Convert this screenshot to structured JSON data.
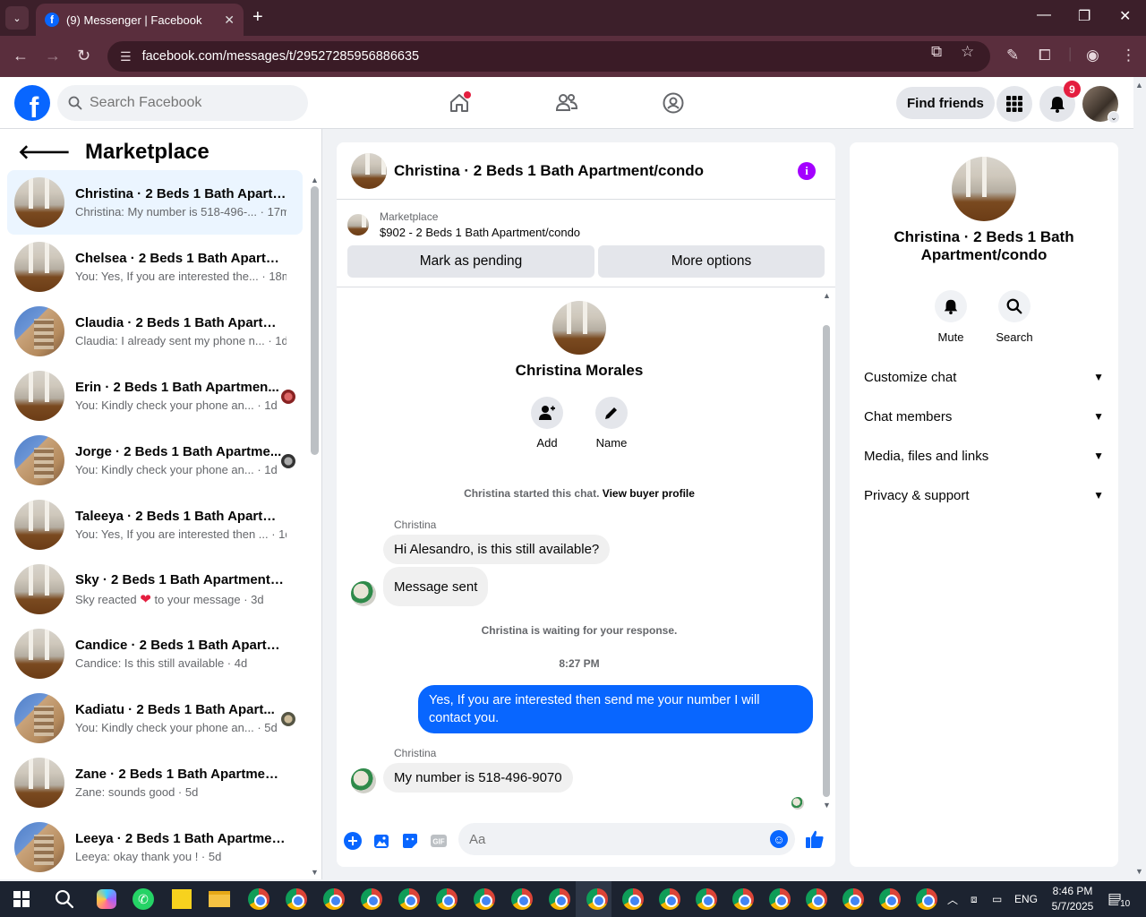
{
  "browser": {
    "tab_title": "(9) Messenger | Facebook",
    "url": "facebook.com/messages/t/29527285956886635"
  },
  "header": {
    "search_placeholder": "Search Facebook",
    "find_friends": "Find friends",
    "notification_count": "9"
  },
  "sidebar": {
    "title": "Marketplace",
    "conversations": [
      {
        "name": "Christina · 2 Beds 1 Bath Apartm...",
        "preview": "Christina: My number is 518-496-... · 17m",
        "avatar": "room",
        "active": true
      },
      {
        "name": "Chelsea · 2 Beds 1 Bath Apartme...",
        "preview": "You: Yes, If you are interested the... · 18m",
        "avatar": "room"
      },
      {
        "name": "Claudia · 2 Beds 1 Bath Apartme...",
        "preview": "Claudia: I already sent my phone n... · 1d",
        "avatar": "building"
      },
      {
        "name": "Erin · 2 Beds 1 Bath Apartmen...",
        "preview": "You: Kindly check your phone an... · 1d",
        "avatar": "room",
        "seen": true
      },
      {
        "name": "Jorge · 2 Beds 1 Bath Apartme...",
        "preview": "You: Kindly check your phone an... · 1d",
        "avatar": "building",
        "seen": true
      },
      {
        "name": "Taleeya · 2 Beds 1 Bath Apartme...",
        "preview": "You: Yes, If you are interested then ... · 1d",
        "avatar": "room"
      },
      {
        "name": "Sky · 2 Beds 1 Bath Apartment/c...",
        "preview_a": "Sky reacted",
        "preview_b": "to your message · 3d",
        "avatar": "room",
        "reaction": "❤"
      },
      {
        "name": "Candice · 2 Beds 1 Bath Apartme...",
        "preview": "Candice: Is this still available · 4d",
        "avatar": "room"
      },
      {
        "name": "Kadiatu · 2 Beds 1 Bath Apart...",
        "preview": "You: Kindly check your phone an... · 5d",
        "avatar": "building",
        "seen": true
      },
      {
        "name": "Zane · 2 Beds 1 Bath Apartment/...",
        "preview": "Zane: sounds good · 5d",
        "avatar": "room"
      },
      {
        "name": "Leeya · 2 Beds 1 Bath Apartment...",
        "preview": "Leeya: okay thank you ! · 5d",
        "avatar": "building"
      }
    ]
  },
  "chat": {
    "title": "Christina · 2 Beds 1 Bath Apartment/condo",
    "marketplace_label": "Marketplace",
    "listing": "$902 - 2 Beds 1 Bath Apartment/condo",
    "mark_pending": "Mark as pending",
    "more_options": "More options",
    "profile_name": "Christina Morales",
    "add_label": "Add",
    "name_label": "Name",
    "started_text": "Christina started this chat.",
    "view_buyer": "View buyer profile",
    "sender1": "Christina",
    "msg1": "Hi Alesandro, is this still available?",
    "msg2": "Message sent",
    "waiting": "Christina is waiting for your response.",
    "time": "8:27 PM",
    "msg_me": "Yes, If you are interested then send me your number I will contact you.",
    "sender2": "Christina",
    "msg3": "My number is 518-496-9070",
    "composer_placeholder": "Aa"
  },
  "details": {
    "title": "Christina · 2 Beds 1 Bath Apartment/condo",
    "mute": "Mute",
    "search": "Search",
    "sections": [
      "Customize chat",
      "Chat members",
      "Media, files and links",
      "Privacy & support"
    ]
  },
  "taskbar": {
    "lang": "ENG",
    "time": "8:46 PM",
    "date": "5/7/2025",
    "notif_count": "10"
  },
  "colors": {
    "brand_blue": "#0866ff",
    "chrome_maroon": "#5a2e3d",
    "badge_red": "#e41e3f",
    "info_purple": "#a400ff"
  }
}
